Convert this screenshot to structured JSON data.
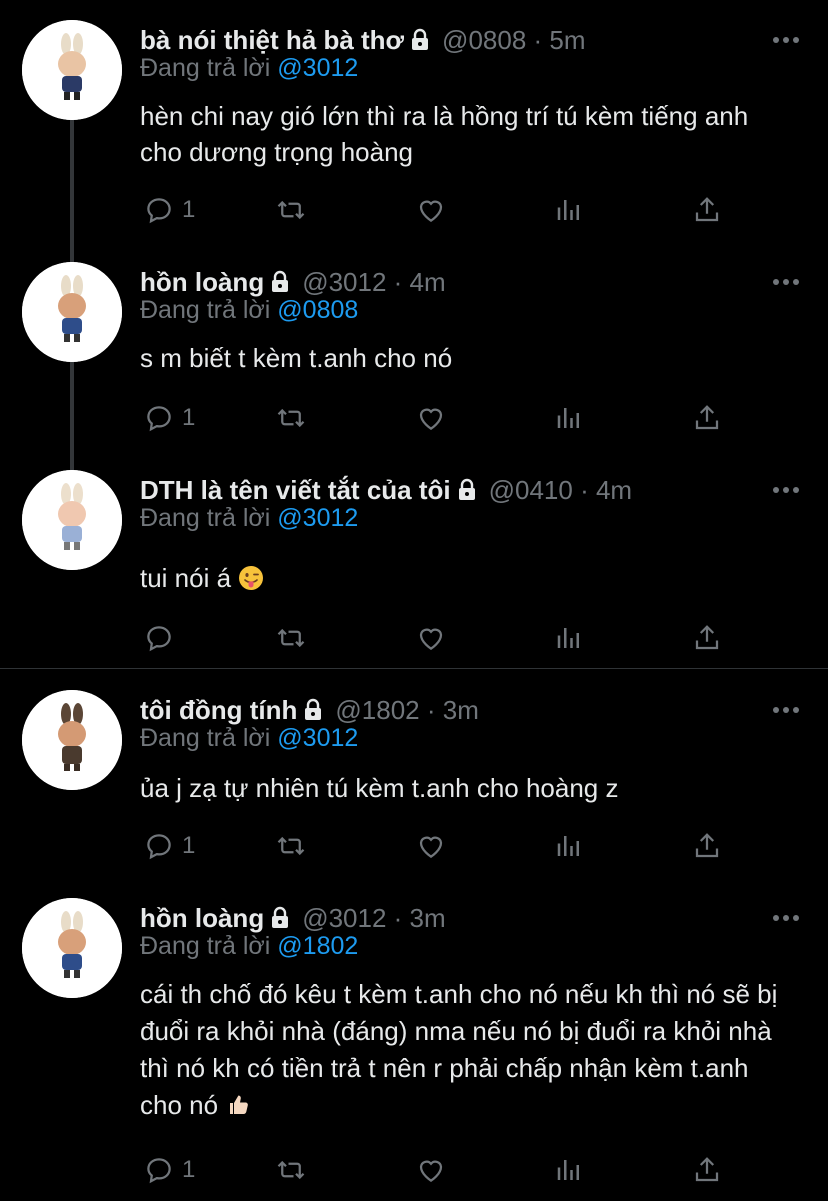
{
  "reply_prefix": "Đang trả lời",
  "colors": {
    "background": "#000000",
    "text": "#e7e9ea",
    "muted": "#71767b",
    "link": "#1d9bf0"
  },
  "tweets": [
    {
      "name": "bà nói thiệt hả bà thơ",
      "handle": "@0808",
      "time": "5m",
      "reply_to": "@3012",
      "text": "hèn chi nay gió lớn thì ra là hồng trí tú kèm tiếng anh cho dương trọng hoàng",
      "reply_count": "1",
      "emoji": ""
    },
    {
      "name": "hồn loàng",
      "handle": "@3012",
      "time": "4m",
      "reply_to": "@0808",
      "text": "s m biết t kèm t.anh cho nó",
      "reply_count": "1",
      "emoji": ""
    },
    {
      "name": "DTH là tên viết tắt của tôi",
      "handle": "@0410",
      "time": "4m",
      "reply_to": "@3012",
      "text": "tui nói á",
      "reply_count": "",
      "emoji": "tongue-face"
    },
    {
      "name": "tôi đồng tính",
      "handle": "@1802",
      "time": "3m",
      "reply_to": "@3012",
      "text": "ủa j zạ tự nhiên tú kèm t.anh cho hoàng z",
      "reply_count": "1",
      "emoji": ""
    },
    {
      "name": "hồn loàng",
      "handle": "@3012",
      "time": "3m",
      "reply_to": "@1802",
      "text": "cái th chố đó kêu t kèm t.anh cho nó nếu kh thì nó sẽ bị đuổi ra khỏi nhà (đáng) nma nếu nó bị đuổi ra khỏi nhà thì nó kh có tiền trả t nên r phải chấp nhận kèm t.anh cho nó",
      "reply_count": "1",
      "emoji": "thumbs-up"
    }
  ]
}
